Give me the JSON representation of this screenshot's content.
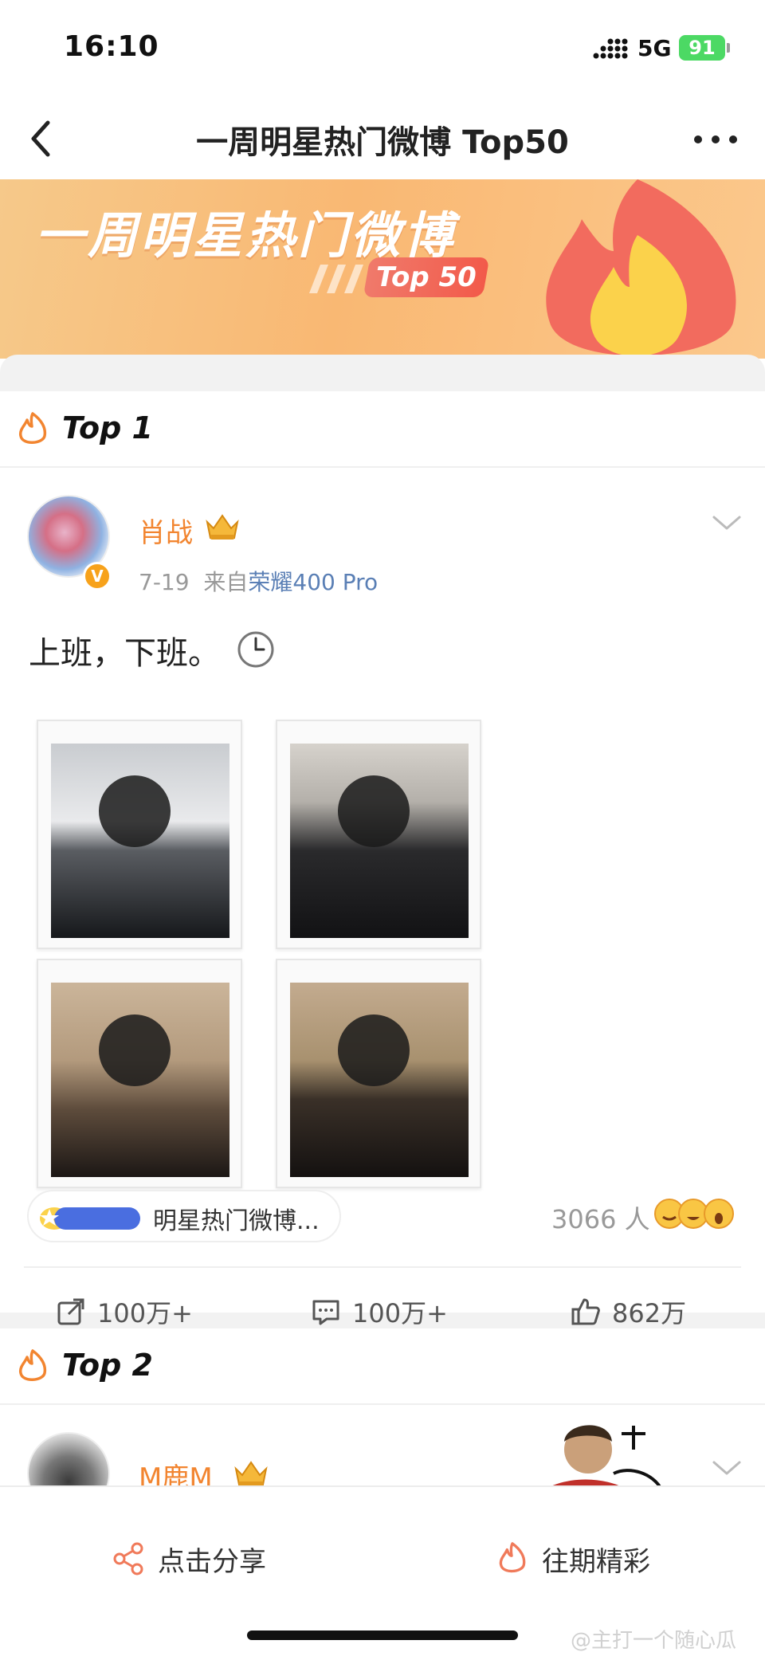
{
  "status_bar": {
    "time": "16:10",
    "network": "5G",
    "battery": "91"
  },
  "nav": {
    "title": "一周明星热门微博 Top50"
  },
  "banner": {
    "title": "一周明星热门微博",
    "badge": "Top 50"
  },
  "posts": [
    {
      "rank": "Top 1",
      "username": "肖战",
      "date": "7-19",
      "source_prefix": "来自",
      "source": "荣耀400 Pro",
      "text": "上班，下班。",
      "topic": "明星热门微博...",
      "people_count": "3066 人",
      "reposts": "100万+",
      "comments": "100万+",
      "likes": "862万"
    },
    {
      "rank": "Top 2",
      "username": "M鹿M"
    }
  ],
  "bottom_bar": {
    "share_label": "点击分享",
    "past_label": "往期精彩"
  },
  "watermark": "@主打一个随心瓜",
  "colors": {
    "accent_orange": "#f28530",
    "banner_bg": "#f9b873",
    "badge_red": "#f25a4a",
    "source_blue": "#5a7fb5",
    "battery_green": "#4cd964"
  },
  "icons": [
    "back-icon",
    "more-icon",
    "fire-icon",
    "crown-icon",
    "clock-icon",
    "repost-icon",
    "comment-icon",
    "like-icon",
    "share-icon",
    "chevron-down-icon",
    "signal-icon"
  ]
}
